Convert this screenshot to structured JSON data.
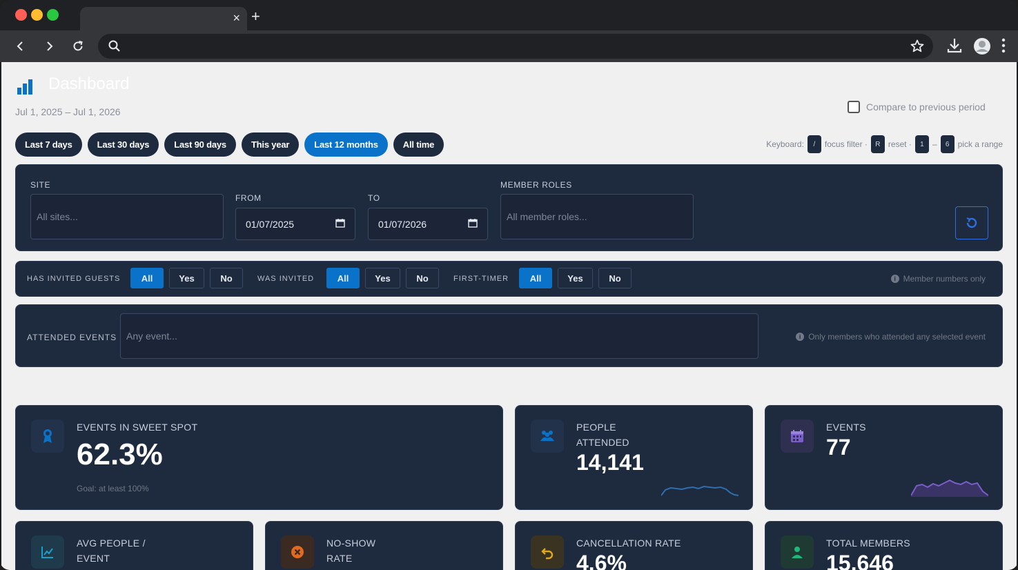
{
  "browser": {
    "tab_close": "×",
    "new_tab": "+"
  },
  "page": {
    "title": "Dashboard",
    "date_range": "Jul 1, 2025 – Jul 1, 2026",
    "compare_label": "Compare to previous period",
    "presets": [
      {
        "label": "Last 7 days",
        "active": false
      },
      {
        "label": "Last 30 days",
        "active": false
      },
      {
        "label": "Last 90 days",
        "active": false
      },
      {
        "label": "This year",
        "active": false
      },
      {
        "label": "Last 12 months",
        "active": true
      },
      {
        "label": "All time",
        "active": false
      }
    ],
    "keyboard": {
      "label": "Keyboard:",
      "k1": "/",
      "t1": "focus filter ·",
      "k2": "R",
      "t2": "reset ·",
      "k3": "1",
      "dash": "–",
      "k4": "6",
      "t3": "pick a range"
    }
  },
  "filters": {
    "site_label": "SITE",
    "site_placeholder": "All sites...",
    "from_label": "FROM",
    "from_value": "01/07/2025",
    "to_label": "TO",
    "to_value": "01/07/2026",
    "roles_label": "MEMBER ROLES",
    "roles_placeholder": "All member roles..."
  },
  "toggles": {
    "groups": [
      {
        "label": "HAS INVITED GUESTS",
        "options": [
          "All",
          "Yes",
          "No"
        ]
      },
      {
        "label": "WAS INVITED",
        "options": [
          "All",
          "Yes",
          "No"
        ]
      },
      {
        "label": "FIRST-TIMER",
        "options": [
          "All",
          "Yes",
          "No"
        ]
      }
    ],
    "hint": "Member numbers only"
  },
  "events_filter": {
    "label": "ATTENDED EVENTS",
    "placeholder": "Any event...",
    "hint": "Only members who attended any selected event"
  },
  "cards": {
    "sweet_spot": {
      "label": "EVENTS IN SWEET SPOT",
      "value": "62.3%",
      "sub": "Goal: at least 100%"
    },
    "people": {
      "label_1": "PEOPLE",
      "label_2": "ATTENDED",
      "value": "14,141"
    },
    "events": {
      "label": "EVENTS",
      "value": "77"
    },
    "avg": {
      "label_1": "AVG PEOPLE /",
      "label_2": "EVENT"
    },
    "noshow": {
      "label_1": "NO-SHOW",
      "label_2": "RATE"
    },
    "cancel": {
      "label": "CANCELLATION RATE",
      "value": "4.6%"
    },
    "members": {
      "label": "TOTAL MEMBERS",
      "value": "15,646"
    }
  },
  "colors": {
    "accent": "#0b72c9",
    "panel": "#1e2a3e",
    "people_spark": "#2f6fb0",
    "events_spark": "#7a5ec9"
  }
}
